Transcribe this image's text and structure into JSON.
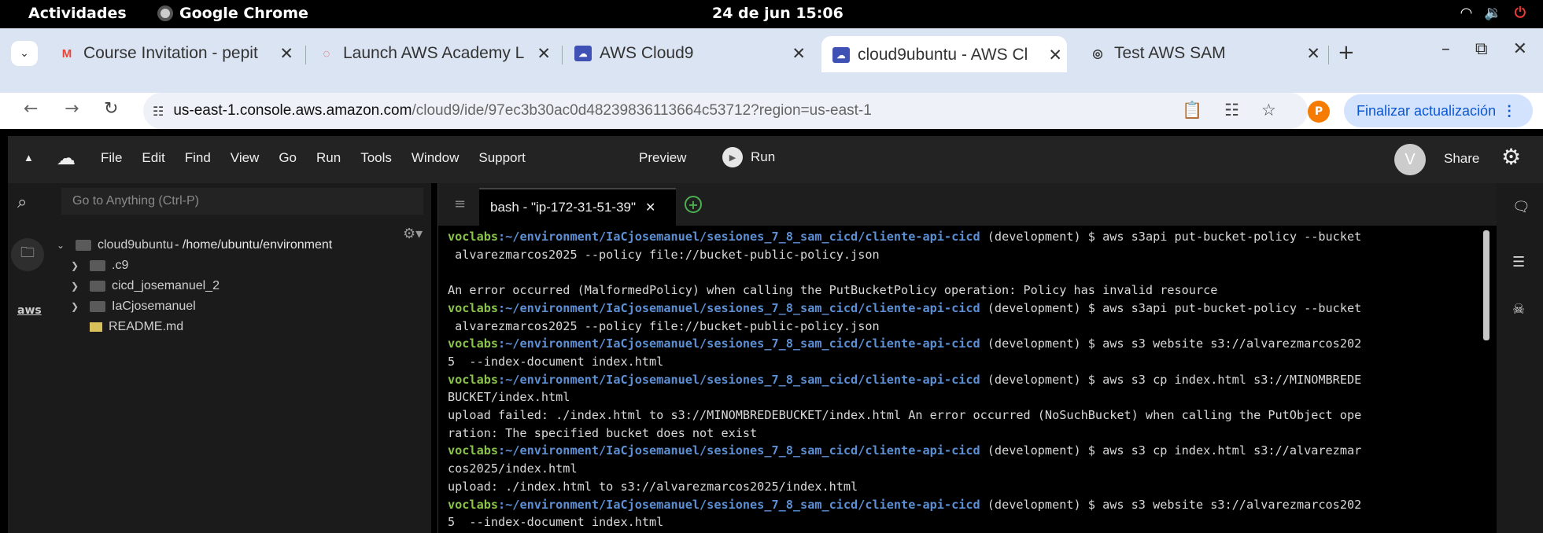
{
  "system_bar": {
    "activities": "Actividades",
    "app_name": "Google Chrome",
    "clock": "24 de jun  15:06",
    "tray_icons": [
      "wifi-icon",
      "volume-icon",
      "power-icon"
    ]
  },
  "browser": {
    "tabs": [
      {
        "title": "Course Invitation - pepit",
        "favicon": "gmail-icon",
        "active": false
      },
      {
        "title": "Launch AWS Academy L",
        "favicon": "loading-icon",
        "active": false
      },
      {
        "title": "AWS Cloud9",
        "favicon": "cloud9-icon",
        "active": false
      },
      {
        "title": "cloud9ubuntu - AWS Cl",
        "favicon": "cloud9-icon",
        "active": true
      },
      {
        "title": "Test AWS SAM",
        "favicon": "globe-icon",
        "active": false
      }
    ],
    "url_host": "us-east-1.console.aws.amazon.com",
    "url_rest": "/cloud9/ide/97ec3b30ac0d48239836113664c53712?region=us-east-1",
    "profile_initial": "P",
    "update_label": "Finalizar actualización"
  },
  "ide": {
    "menu": [
      "File",
      "Edit",
      "Find",
      "View",
      "Go",
      "Run",
      "Tools",
      "Window",
      "Support"
    ],
    "preview_label": "Preview",
    "run_label": "Run",
    "avatar_initial": "V",
    "share_label": "Share",
    "search_placeholder": "Go to Anything (Ctrl-P)",
    "tree": {
      "root_name": "cloud9ubuntu",
      "root_path": " - /home/ubuntu/environment",
      "children": [
        {
          "name": ".c9",
          "type": "folder"
        },
        {
          "name": "cicd_josemanuel_2",
          "type": "folder"
        },
        {
          "name": "IaCjosemanuel",
          "type": "folder"
        },
        {
          "name": "README.md",
          "type": "file"
        }
      ]
    },
    "terminal_tab": "bash - \"ip-172-31-51-39\"",
    "terminal": {
      "user": "voclabs",
      "path": ":~/environment/IaCjosemanuel/sesiones_7_8_sam_cicd/cliente-api-cicd",
      "lines": [
        {
          "type": "prompt",
          "cmd": " (development) $ aws s3api put-bucket-policy --bucket"
        },
        {
          "type": "out",
          "text": " alvarezmarcos2025 --policy file://bucket-public-policy.json"
        },
        {
          "type": "out",
          "text": ""
        },
        {
          "type": "out",
          "text": "An error occurred (MalformedPolicy) when calling the PutBucketPolicy operation: Policy has invalid resource"
        },
        {
          "type": "prompt",
          "cmd": " (development) $ aws s3api put-bucket-policy --bucket"
        },
        {
          "type": "out",
          "text": " alvarezmarcos2025 --policy file://bucket-public-policy.json"
        },
        {
          "type": "prompt",
          "cmd": " (development) $ aws s3 website s3://alvarezmarcos202"
        },
        {
          "type": "out",
          "text": "5  --index-document index.html"
        },
        {
          "type": "prompt",
          "cmd": " (development) $ aws s3 cp index.html s3://MINOMBREDE"
        },
        {
          "type": "out",
          "text": "BUCKET/index.html"
        },
        {
          "type": "out",
          "text": "upload failed: ./index.html to s3://MINOMBREDEBUCKET/index.html An error occurred (NoSuchBucket) when calling the PutObject ope"
        },
        {
          "type": "out",
          "text": "ration: The specified bucket does not exist"
        },
        {
          "type": "prompt",
          "cmd": " (development) $ aws s3 cp index.html s3://alvarezmar"
        },
        {
          "type": "out",
          "text": "cos2025/index.html"
        },
        {
          "type": "out",
          "text": "upload: ./index.html to s3://alvarezmarcos2025/index.html"
        },
        {
          "type": "prompt",
          "cmd": " (development) $ aws s3 website s3://alvarezmarcos202"
        },
        {
          "type": "out",
          "text": "5  --index-document index.html"
        }
      ]
    }
  }
}
